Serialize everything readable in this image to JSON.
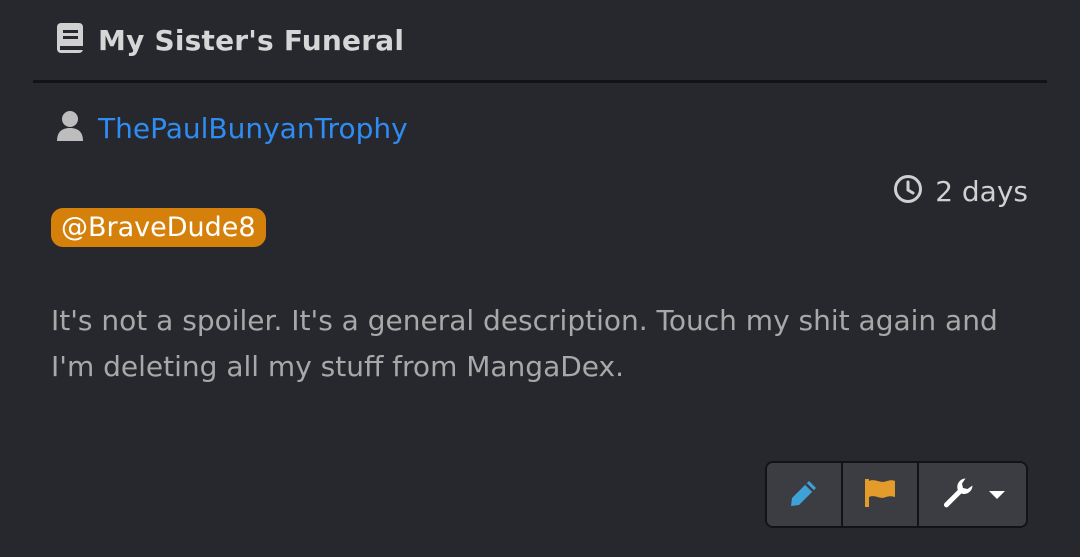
{
  "post": {
    "title": "My Sister's Funeral",
    "author": "ThePaulBunyanTrophy",
    "time": "2 days",
    "mention": "@BraveDude8",
    "body": "It's not a spoiler. It's a general description. Touch my shit again and I'm deleting all my stuff from MangaDex."
  },
  "icons": {
    "title": "book-icon",
    "author": "user-icon",
    "time": "clock-icon",
    "edit": "pencil-icon",
    "report": "flag-icon",
    "tools": "wrench-icon",
    "dropdown": "caret-down-icon"
  },
  "colors": {
    "background": "#26282d",
    "link": "#2f8cf2",
    "mention_bg": "#d4800a",
    "edit_icon": "#3ea2d6",
    "report_icon": "#e39b2c"
  }
}
